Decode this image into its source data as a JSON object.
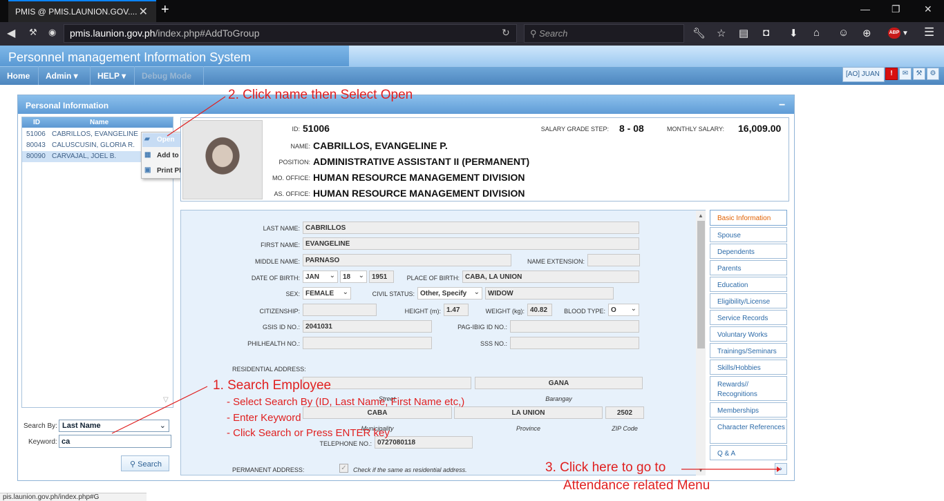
{
  "browser": {
    "tab_title": "PMIS @ PMIS.LAUNION.GOV....",
    "url_host": "pmis.launion.gov.ph",
    "url_path": "/index.php#AddToGroup",
    "search_placeholder": "Search",
    "abp_label": "ABP"
  },
  "app": {
    "title": "Personnel management Information System",
    "menu": [
      {
        "label": "Home"
      },
      {
        "label": "Admin ▾"
      },
      {
        "label": "HELP ▾"
      },
      {
        "label": "Debug Mode"
      }
    ],
    "user_label": "[AO] JUAN",
    "alert_label": "!"
  },
  "panel": {
    "title": "Personal Information"
  },
  "employee_list": {
    "col_id": "ID",
    "col_name": "Name",
    "rows": [
      {
        "id": "51006",
        "name": "CABRILLOS, EVANGELINE"
      },
      {
        "id": "80043",
        "name": "CALUSCUSIN, GLORIA R."
      },
      {
        "id": "80090",
        "name": "CARVAJAL, JOEL B."
      }
    ]
  },
  "context_menu": {
    "items": [
      "Open",
      "Add to Group",
      "Print PDS"
    ]
  },
  "search": {
    "by_label": "Search By:",
    "by_value": "Last Name",
    "keyword_label": "Keyword:",
    "keyword_value": "ca",
    "button_label": "Search"
  },
  "summary": {
    "id_label": "ID:",
    "id_value": "51006",
    "sg_label": "SALARY GRADE STEP:",
    "sg_value": "8 - 08",
    "ms_label": "MONTHLY SALARY:",
    "ms_value": "16,009.00",
    "name_label": "NAME:",
    "name_value": "CABRILLOS, EVANGELINE P.",
    "pos_label": "POSITION:",
    "pos_value": "ADMINISTRATIVE ASSISTANT II (PERMANENT)",
    "mo_label": "MO. OFFICE:",
    "mo_value": "HUMAN RESOURCE MANAGEMENT DIVISION",
    "as_label": "AS. OFFICE:",
    "as_value": "HUMAN RESOURCE MANAGEMENT DIVISION"
  },
  "form": {
    "last_name_label": "LAST NAME:",
    "last_name": "CABRILLOS",
    "first_name_label": "FIRST NAME:",
    "first_name": "EVANGELINE",
    "middle_name_label": "MIDDLE NAME:",
    "middle_name": "PARNASO",
    "name_ext_label": "NAME EXTENSION:",
    "name_ext": "",
    "dob_label": "DATE OF BIRTH:",
    "dob_month": "JAN",
    "dob_day": "18",
    "dob_year": "1951",
    "pob_label": "PLACE OF BIRTH:",
    "pob": "CABA, LA UNION",
    "sex_label": "SEX:",
    "sex": "FEMALE",
    "civil_label": "CIVIL STATUS:",
    "civil": "Other, Specify",
    "civil_other": "WIDOW",
    "citizenship_label": "CITIZENSHIP:",
    "citizenship": "",
    "height_label": "HEIGHT (m):",
    "height": "1.47",
    "weight_label": "WEIGHT (kg):",
    "weight": "40.82",
    "blood_label": "BLOOD TYPE:",
    "blood": "O",
    "gsis_label": "GSIS ID NO.:",
    "gsis": "2041031",
    "pagibig_label": "PAG-IBIG ID NO.:",
    "pagibig": "",
    "philhealth_label": "PHILHEALTH NO.:",
    "philhealth": "",
    "sss_label": "SSS NO.:",
    "sss": "",
    "res_addr_label": "RESIDENTIAL ADDRESS:",
    "street": "",
    "street_label": "Street",
    "barangay": "GANA",
    "barangay_label": "Barangay",
    "municipality": "CABA",
    "municipality_label": "Municipality",
    "province": "LA UNION",
    "province_label": "Province",
    "zip": "2502",
    "zip_label": "ZIP Code",
    "tel_label": "TELEPHONE NO.:",
    "tel": "0727080118",
    "perm_addr_label": "PERMANENT ADDRESS:",
    "same_as_label": "Check if the same as residential address."
  },
  "tabs": [
    "Basic Information",
    "Spouse",
    "Dependents",
    "Parents",
    "Education",
    "Eligibility/License",
    "Service Records",
    "Voluntary Works",
    "Trainings/Seminars",
    "Skills/Hobbies",
    "Rewards// Recognitions",
    "Memberships",
    "Character References",
    "Q & A"
  ],
  "annotations": {
    "step2": "2. Click name then Select Open",
    "step1_title": "1. Search Employee",
    "step1_a": "- Select Search By (ID, Last Name, First Name etc,)",
    "step1_b": "- Enter Keyword",
    "step1_c": "- Click Search or Press ENTER key",
    "step3_a": "3. Click here to go to",
    "step3_b": "Attendance related Menu"
  },
  "statusbar": "pis.launion.gov.ph/index.php#G"
}
